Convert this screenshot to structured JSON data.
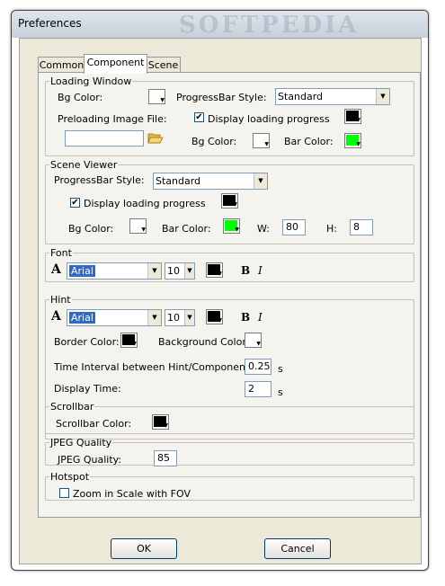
{
  "window": {
    "title": "Preferences",
    "watermark": "SOFTPEDIA"
  },
  "tabs": [
    {
      "label": "Common"
    },
    {
      "label": "Component"
    },
    {
      "label": "Scene"
    }
  ],
  "loading_window": {
    "legend": "Loading Window",
    "bg_color_label": "Bg Color:",
    "progressbar_style_label": "ProgressBar Style:",
    "progressbar_style_value": "Standard",
    "preloading_label": "Preloading Image File:",
    "preloading_value": "",
    "display_progress_label": "Display loading progress",
    "display_progress_checked": true,
    "bg_color2_label": "Bg Color:",
    "bar_color_label": "Bar Color:",
    "colors": {
      "bg": "#ffffff",
      "progress_swatch": "#000000",
      "bg2": "#ffffff",
      "bar": "#00ff00"
    }
  },
  "scene_viewer": {
    "legend": "Scene Viewer",
    "progressbar_style_label": "ProgressBar Style:",
    "progressbar_style_value": "Standard",
    "display_progress_label": "Display loading progress",
    "display_progress_checked": true,
    "bg_color_label": "Bg Color:",
    "bar_color_label": "Bar Color:",
    "w_label": "W:",
    "w_value": "80",
    "h_label": "H:",
    "h_value": "8",
    "colors": {
      "progress_swatch": "#000000",
      "bg": "#ffffff",
      "bar": "#00ff00"
    }
  },
  "font": {
    "legend": "Font",
    "font_value": "Arial",
    "size_value": "10",
    "bold_label": "B",
    "italic_label": "I",
    "font_icon": "A",
    "color": "#000000"
  },
  "hint": {
    "legend": "Hint",
    "font_value": "Arial",
    "size_value": "10",
    "bold_label": "B",
    "italic_label": "I",
    "font_icon": "A",
    "color": "#000000",
    "border_color_label": "Border Color:",
    "background_color_label": "Background Color:",
    "interval_label": "Time Interval between Hint/Component:",
    "interval_value": "0.25",
    "interval_unit": "s",
    "display_time_label": "Display Time:",
    "display_time_value": "2",
    "display_time_unit": "s",
    "colors": {
      "border": "#000000",
      "background": "#ffffff"
    }
  },
  "scrollbar": {
    "legend": "Scrollbar",
    "color_label": "Scrollbar Color:",
    "color": "#000000"
  },
  "jpeg": {
    "legend": "JPEG Quality",
    "quality_label": "JPEG Quality:",
    "quality_value": "85"
  },
  "hotspot": {
    "legend": "Hotspot",
    "zoom_label": "Zoom in Scale with FOV",
    "zoom_checked": false
  },
  "buttons": {
    "ok": "OK",
    "cancel": "Cancel"
  },
  "icons": {
    "check": "✔",
    "dropdown": "▼",
    "folder": "folder-open-icon"
  }
}
